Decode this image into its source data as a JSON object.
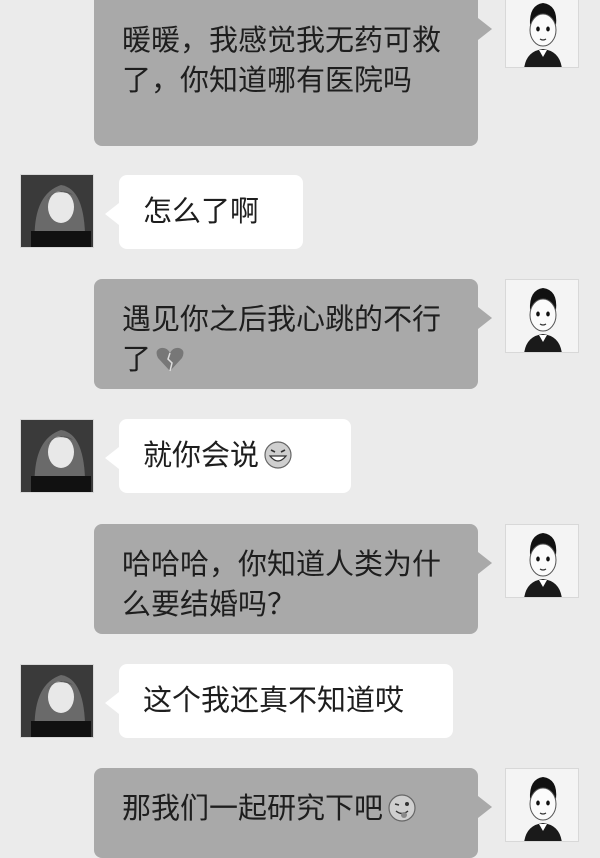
{
  "messages": [
    {
      "side": "me",
      "text": "暖暖，我感觉我无药可救了，你知道哪有医院吗"
    },
    {
      "side": "her",
      "text": "怎么了啊"
    },
    {
      "side": "me",
      "text": "遇见你之后我心跳的不行了",
      "emoji": "broken-heart-icon"
    },
    {
      "side": "her",
      "text": "就你会说",
      "emoji": "grinning-face-icon"
    },
    {
      "side": "me",
      "text": "哈哈哈，你知道人类为什么要结婚吗？"
    },
    {
      "side": "her",
      "text": "这个我还真不知道哎"
    },
    {
      "side": "me",
      "text": "那我们一起研究下吧",
      "emoji": "winking-tongue-face-icon"
    }
  ],
  "colors": {
    "background": "#ebebeb",
    "my_bubble": "#a9a9a9",
    "her_bubble": "#ffffff"
  }
}
